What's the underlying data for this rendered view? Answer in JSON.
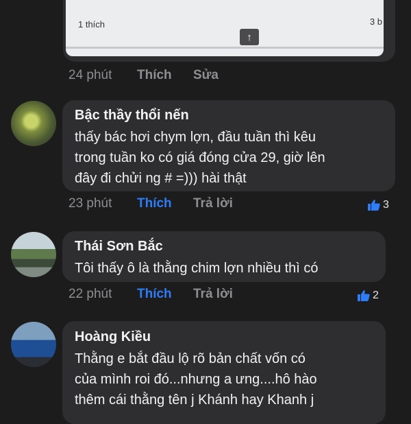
{
  "top_card": {
    "like_label": "1 thích",
    "partial_label": "3 b",
    "time": "24 phút",
    "like": "Thích",
    "edit": "Sửa"
  },
  "comments": [
    {
      "author": "Bậc thầy thổi nến",
      "lines": [
        "thấy bác hơi chym lợn, đầu tuần thì kêu",
        "trong tuần ko có giá đóng cửa 29, giờ lên",
        "đây đi chửi ng # =))) hài thật"
      ],
      "time": "23 phút",
      "like": "Thích",
      "reply": "Trả lời",
      "like_count": "3"
    },
    {
      "author": "Thái Sơn Bắc",
      "lines": [
        "Tôi thấy ô là thằng chim lợn nhiều thì có"
      ],
      "time": "22 phút",
      "like": "Thích",
      "reply": "Trả lời",
      "like_count": "2"
    },
    {
      "author": "Hoàng Kiều",
      "lines": [
        "Thằng e bắt đầu lộ rõ bản chất vốn có",
        "của mình roi đó...nhưng a ưng....hô hào",
        "thêm cái thằng tên j Khánh hay Khanh j"
      ]
    }
  ],
  "colors": {
    "background": "#1c1c1d",
    "bubble": "#2e2e30",
    "like_active": "#2e7cf6",
    "meta": "#8e8e93"
  },
  "icons": {
    "like_reaction": "thumbs-up-icon",
    "scroll_up": "arrow-up-icon"
  }
}
